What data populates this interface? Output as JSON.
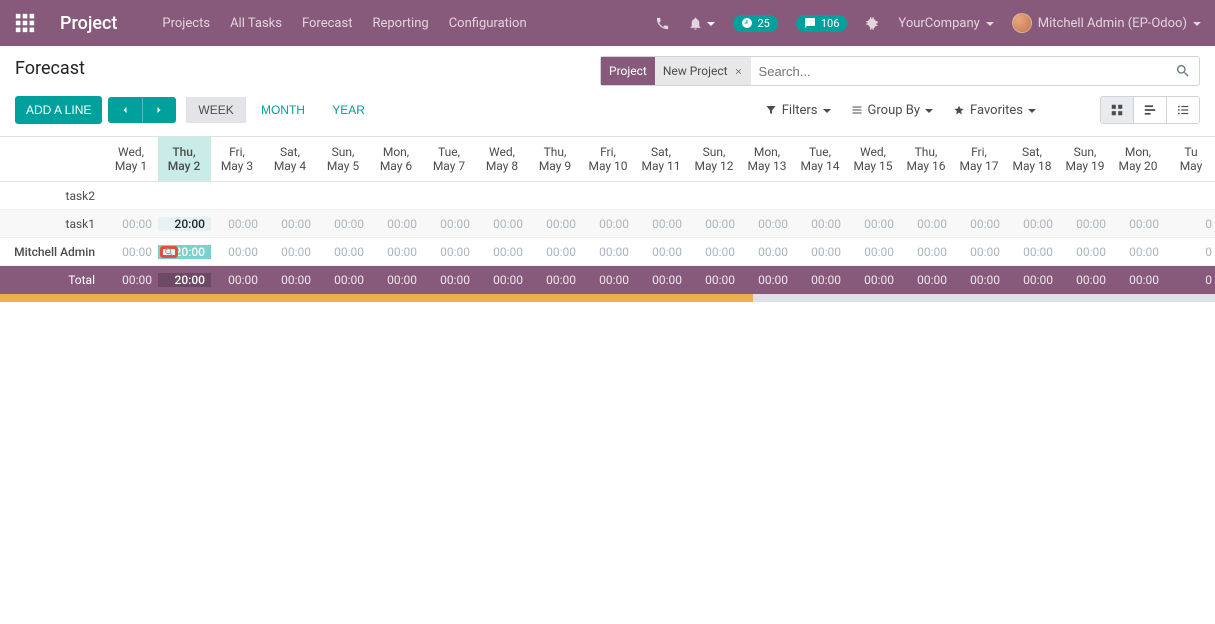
{
  "header": {
    "brand": "Project",
    "nav": [
      "Projects",
      "All Tasks",
      "Forecast",
      "Reporting",
      "Configuration"
    ],
    "activity_count": "25",
    "msg_count": "106",
    "company": "YourCompany",
    "user": "Mitchell Admin (EP-Odoo)"
  },
  "breadcrumb": "Forecast",
  "search": {
    "facet_label": "Project",
    "facet_value": "New Project",
    "placeholder": "Search..."
  },
  "toolbar": {
    "add_line": "ADD A LINE",
    "scales": {
      "week": "WEEK",
      "month": "MONTH",
      "year": "YEAR"
    },
    "filters": "Filters",
    "group_by": "Group By",
    "favorites": "Favorites"
  },
  "dates": [
    {
      "wd": "Wed,",
      "md": "May 1"
    },
    {
      "wd": "Thu,",
      "md": "May 2",
      "today": true
    },
    {
      "wd": "Fri,",
      "md": "May 3"
    },
    {
      "wd": "Sat,",
      "md": "May 4"
    },
    {
      "wd": "Sun,",
      "md": "May 5"
    },
    {
      "wd": "Mon,",
      "md": "May 6"
    },
    {
      "wd": "Tue,",
      "md": "May 7"
    },
    {
      "wd": "Wed,",
      "md": "May 8"
    },
    {
      "wd": "Thu,",
      "md": "May 9"
    },
    {
      "wd": "Fri,",
      "md": "May 10"
    },
    {
      "wd": "Sat,",
      "md": "May 11"
    },
    {
      "wd": "Sun,",
      "md": "May 12"
    },
    {
      "wd": "Mon,",
      "md": "May 13"
    },
    {
      "wd": "Tue,",
      "md": "May 14"
    },
    {
      "wd": "Wed,",
      "md": "May 15"
    },
    {
      "wd": "Thu,",
      "md": "May 16"
    },
    {
      "wd": "Fri,",
      "md": "May 17"
    },
    {
      "wd": "Sat,",
      "md": "May 18"
    },
    {
      "wd": "Sun,",
      "md": "May 19"
    },
    {
      "wd": "Mon,",
      "md": "May 20"
    },
    {
      "wd": "Tu",
      "md": "May"
    }
  ],
  "rows": [
    {
      "label": "task2",
      "strong": false,
      "vals": [
        null,
        null,
        null,
        null,
        null,
        null,
        null,
        null,
        null,
        null,
        null,
        null,
        null,
        null,
        null,
        null,
        null,
        null,
        null,
        null,
        null
      ]
    },
    {
      "label": "task1",
      "strong": false,
      "vals": [
        "00:00",
        "20:00",
        "00:00",
        "00:00",
        "00:00",
        "00:00",
        "00:00",
        "00:00",
        "00:00",
        "00:00",
        "00:00",
        "00:00",
        "00:00",
        "00:00",
        "00:00",
        "00:00",
        "00:00",
        "00:00",
        "00:00",
        "00:00",
        "0"
      ]
    },
    {
      "label": "Mitchell Admin",
      "strong": true,
      "highlight": true,
      "vals": [
        "00:00",
        "20:00",
        "00:00",
        "00:00",
        "00:00",
        "00:00",
        "00:00",
        "00:00",
        "00:00",
        "00:00",
        "00:00",
        "00:00",
        "00:00",
        "00:00",
        "00:00",
        "00:00",
        "00:00",
        "00:00",
        "00:00",
        "00:00",
        "0"
      ]
    }
  ],
  "total": {
    "label": "Total",
    "vals": [
      "00:00",
      "20:00",
      "00:00",
      "00:00",
      "00:00",
      "00:00",
      "00:00",
      "00:00",
      "00:00",
      "00:00",
      "00:00",
      "00:00",
      "00:00",
      "00:00",
      "00:00",
      "00:00",
      "00:00",
      "00:00",
      "00:00",
      "00:00",
      "0"
    ]
  },
  "progress": {
    "orange_pct": 62,
    "gray_pct": 38
  }
}
